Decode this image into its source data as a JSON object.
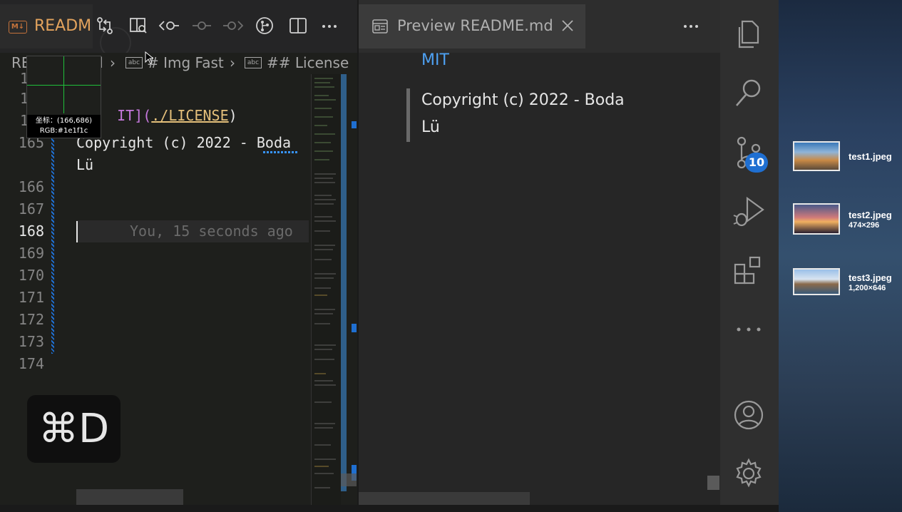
{
  "editor": {
    "tab_title": "READM",
    "breadcrumb": {
      "crumb1": "RE",
      "crumb1_tail": "d",
      "crumb2": "# Img Fast",
      "crumb3": "## License"
    },
    "lines": [
      {
        "num": "165",
        "text": "Copyright (c) 2022 - Boda"
      },
      {
        "num": "",
        "text": "Lü"
      },
      {
        "num": "166",
        "text": ""
      },
      {
        "num": "167",
        "text": ""
      },
      {
        "num": "168",
        "text": ""
      },
      {
        "num": "169",
        "text": ""
      },
      {
        "num": "170",
        "text": ""
      },
      {
        "num": "171",
        "text": ""
      },
      {
        "num": "172",
        "text": ""
      },
      {
        "num": "173",
        "text": ""
      },
      {
        "num": "174",
        "text": ""
      }
    ],
    "partial_lines": {
      "l1": "1",
      "l2": "1",
      "l3": "1"
    },
    "license_line": {
      "prefix": "IT](",
      "link": "./LICENSE",
      "suffix": ")"
    },
    "git_blame": "You, 15 seconds ago"
  },
  "color_picker": {
    "coords_label": "坐标：(166,686)",
    "rgb_label": "RGB:#1e1f1c"
  },
  "shortcut_overlay": {
    "key": "⌘D"
  },
  "preview": {
    "tab_title": "Preview README.md",
    "heading": "MIT",
    "quote_line1": "Copyright (c) 2022 - Boda",
    "quote_line2": "Lü"
  },
  "activity_bar": {
    "scm_badge": "10",
    "items": [
      "files-icon",
      "search-icon",
      "source-control-icon",
      "run-debug-icon",
      "extensions-icon",
      "more-icon",
      "account-icon",
      "settings-icon"
    ]
  },
  "desktop_files": [
    {
      "name": "test1.jpeg",
      "dims": ""
    },
    {
      "name": "test2.jpeg",
      "dims": "474×296"
    },
    {
      "name": "test3.jpeg",
      "dims": "1,200×646"
    }
  ],
  "colors": {
    "accent_blue": "#1f6fd1",
    "link_yellow": "#e5c07b",
    "preview_link": "#4ea1f3"
  }
}
